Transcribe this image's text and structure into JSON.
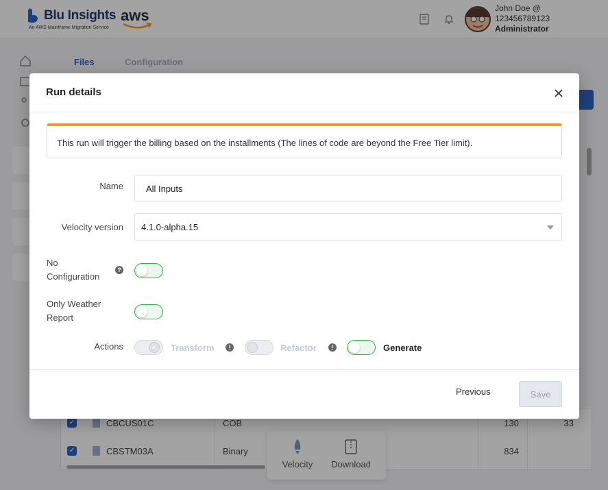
{
  "app": {
    "brand_name": "Blu Insights",
    "brand_sub": "An AWS Mainframe Migration Service",
    "partner": "aws",
    "user_line1": "John Doe @",
    "user_line2": "123456789123",
    "user_role": "Administrator"
  },
  "background": {
    "tabs": [
      "Files",
      "Configuration"
    ],
    "rows": [
      {
        "name": "CBCUS01C",
        "type": "COB",
        "count": "130",
        "extra": "33"
      },
      {
        "name": "CBSTM03A",
        "type": "Binary",
        "count": "834",
        "extra": ""
      }
    ],
    "float_actions": [
      "Velocity",
      "Download"
    ]
  },
  "modal": {
    "title": "Run details",
    "alert": "This run will trigger the billing based on the installments (The lines of code are beyond the Free Tier limit).",
    "name_label": "Name",
    "name_value": "All Inputs",
    "velocity_label": "Velocity version",
    "velocity_value": "4.1.0-alpha.15",
    "no_config_label_1": "No",
    "no_config_label_2": "Configuration",
    "weather_label_1": "Only Weather",
    "weather_label_2": "Report",
    "actions_label": "Actions",
    "actions": {
      "transform": "Transform",
      "refactor": "Refactor",
      "generate": "Generate"
    },
    "previous": "Previous",
    "save": "Save"
  },
  "colors": {
    "accent": "#2c64c6",
    "warning": "#f29d21",
    "toggle_on": "#2db34a"
  }
}
